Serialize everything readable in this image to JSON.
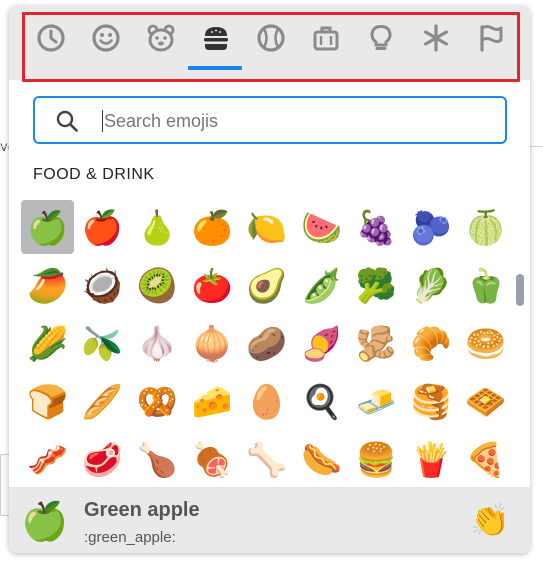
{
  "background_fragment": "ve",
  "categories": [
    {
      "name": "Recent",
      "icon": "clock-icon"
    },
    {
      "name": "Smileys & People",
      "icon": "smiley-icon"
    },
    {
      "name": "Animals & Nature",
      "icon": "bear-icon"
    },
    {
      "name": "Food & Drink",
      "icon": "burger-icon",
      "active": true
    },
    {
      "name": "Activity",
      "icon": "ball-icon"
    },
    {
      "name": "Travel & Places",
      "icon": "briefcase-icon"
    },
    {
      "name": "Objects",
      "icon": "lightbulb-icon"
    },
    {
      "name": "Symbols",
      "icon": "asterisk-icon"
    },
    {
      "name": "Flags",
      "icon": "flag-icon"
    }
  ],
  "colors": {
    "highlight_border": "#e2242d",
    "accent": "#1b86e8",
    "bar_bg": "#e9e9ea",
    "selected_cell": "#b8b9bb"
  },
  "search": {
    "placeholder": "Search emojis",
    "value": ""
  },
  "section_title": "FOOD & DRINK",
  "emoji_rows": [
    [
      "🍏",
      "🍎",
      "🍐",
      "🍊",
      "🍋",
      "🍉",
      "🍇",
      "🫐",
      "🍈"
    ],
    [
      "🥭",
      "🥥",
      "🥝",
      "🍅",
      "🥑",
      "🫛",
      "🥦",
      "🥬",
      "🫑"
    ],
    [
      "🌽",
      "🫒",
      "🧄",
      "🧅",
      "🥔",
      "🍠",
      "🫚",
      "🥐",
      "🥯"
    ],
    [
      "🍞",
      "🥖",
      "🥨",
      "🧀",
      "🥚",
      "🍳",
      "🧈",
      "🥞",
      "🧇"
    ],
    [
      "🥓",
      "🥩",
      "🍗",
      "🍖",
      "🦴",
      "🌭",
      "🍔",
      "🍟",
      "🍕"
    ],
    [
      "🫓",
      "🥪",
      "🥙",
      "🧆",
      "🌮",
      "🌯",
      "🫔",
      "🥗",
      "🥘"
    ]
  ],
  "selected": {
    "emoji": "🍏",
    "name": "Green apple",
    "shortcode": ":green_apple:"
  },
  "skin_tone_button": {
    "emoji": "👏",
    "icon": "clapping-hands-icon"
  }
}
